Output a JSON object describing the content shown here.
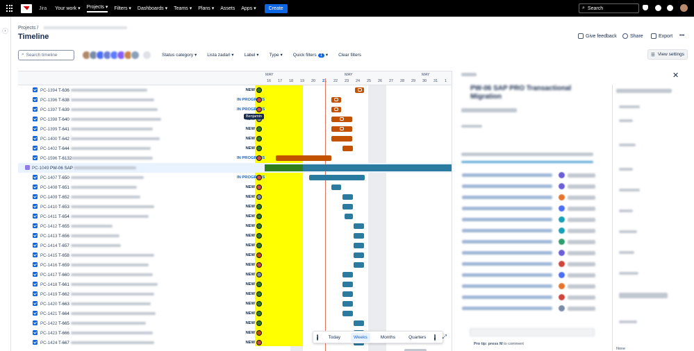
{
  "topbar": {
    "app_label": "Jira",
    "nav": [
      "Your work",
      "Projects",
      "Filters",
      "Dashboards",
      "Teams",
      "Plans",
      "Assets",
      "Apps"
    ],
    "create": "Create",
    "search": "Search"
  },
  "breadcrumb": {
    "root": "Projects",
    "sep": "/"
  },
  "page_title": "Timeline",
  "actions": {
    "feedback": "Give feedback",
    "share": "Share",
    "export": "Export",
    "more": "•••"
  },
  "toolbar": {
    "search_placeholder": "Search timeline",
    "status_category": "Status category",
    "lista": "Lista zadań",
    "label": "Label",
    "type": "Type",
    "quick_filters": "Quick filters",
    "quick_filters_count": "1",
    "clear": "Clear filters",
    "view_settings": "View settings"
  },
  "timeline_header": {
    "months": [
      "MAY",
      "MAY",
      "MAY"
    ],
    "days": [
      "16",
      "17",
      "18",
      "19",
      "20",
      "21",
      "22",
      "23",
      "24",
      "25",
      "26",
      "27",
      "28",
      "29",
      "30",
      "31",
      "1"
    ],
    "today_day": "21"
  },
  "tooltip": "Benjamin",
  "rows": [
    {
      "key": "PC-1394",
      "tkey": "T-636",
      "status": "NEW",
      "prog": false
    },
    {
      "key": "PC-1396",
      "tkey": "T-638",
      "status": "IN PROGRESS",
      "prog": true
    },
    {
      "key": "PC-1397",
      "tkey": "T-639",
      "status": "IN PROGRESS",
      "prog": true
    },
    {
      "key": "PC-1398",
      "tkey": "T-640",
      "status": "NEW",
      "prog": false
    },
    {
      "key": "PC-1399",
      "tkey": "T-641",
      "status": "NEW",
      "prog": false
    },
    {
      "key": "PC-1400",
      "tkey": "T-642",
      "status": "NEW",
      "prog": false
    },
    {
      "key": "PC-1402",
      "tkey": "T-644",
      "status": "NEW",
      "prog": false
    },
    {
      "key": "PC-1596",
      "tkey": "T-6132",
      "status": "IN PROGRESS",
      "prog": true
    },
    {
      "key": "PC-1049",
      "tkey": "PW-06 SAP",
      "status": "",
      "prog": false,
      "epic": true
    },
    {
      "key": "PC-1407",
      "tkey": "T-650",
      "status": "IN PROGRESS",
      "prog": true
    },
    {
      "key": "PC-1408",
      "tkey": "T-651",
      "status": "NEW",
      "prog": false
    },
    {
      "key": "PC-1409",
      "tkey": "T-652",
      "status": "NEW",
      "prog": false
    },
    {
      "key": "PC-1410",
      "tkey": "T-653",
      "status": "NEW",
      "prog": false
    },
    {
      "key": "PC-1411",
      "tkey": "T-654",
      "status": "NEW",
      "prog": false
    },
    {
      "key": "PC-1412",
      "tkey": "T-655",
      "status": "NEW",
      "prog": false
    },
    {
      "key": "PC-1413",
      "tkey": "T-656",
      "status": "NEW",
      "prog": false
    },
    {
      "key": "PC-1414",
      "tkey": "T-657",
      "status": "NEW",
      "prog": false
    },
    {
      "key": "PC-1415",
      "tkey": "T-658",
      "status": "NEW",
      "prog": false
    },
    {
      "key": "PC-1416",
      "tkey": "T-659",
      "status": "NEW",
      "prog": false
    },
    {
      "key": "PC-1417",
      "tkey": "T-660",
      "status": "NEW",
      "prog": false
    },
    {
      "key": "PC-1418",
      "tkey": "T-661",
      "status": "NEW",
      "prog": false
    },
    {
      "key": "PC-1419",
      "tkey": "T-662",
      "status": "NEW",
      "prog": false
    },
    {
      "key": "PC-1420",
      "tkey": "T-663",
      "status": "NEW",
      "prog": false
    },
    {
      "key": "PC-1421",
      "tkey": "T-664",
      "status": "NEW",
      "prog": false
    },
    {
      "key": "PC-1422",
      "tkey": "T-665",
      "status": "NEW",
      "prog": false
    },
    {
      "key": "PC-1423",
      "tkey": "T-666",
      "status": "NEW",
      "prog": false
    },
    {
      "key": "PC-1424",
      "tkey": "T-667",
      "status": "NEW",
      "prog": false
    }
  ],
  "zoom": {
    "today": "Today",
    "weeks": "Weeks",
    "months": "Months",
    "quarters": "Quarters",
    "selected": "Weeks"
  },
  "detail": {
    "title": "PW-06 SAP PRO Transactional Migration",
    "protip": "Pro tip: press",
    "protip_key": "M",
    "protip_end": "to comment",
    "field_value": "None"
  },
  "colors": {
    "topbar": "#000000",
    "accent": "#0c66e4",
    "highlight": "#ffff00",
    "orange_bar": "#c25100",
    "blue_bar": "#2b7a9f"
  }
}
